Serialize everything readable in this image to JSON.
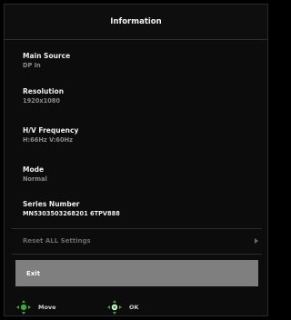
{
  "osd": {
    "title": "Information",
    "items": [
      {
        "label": "Main Source",
        "value": "DP In"
      },
      {
        "label": "Resolution",
        "value": "1920x1080"
      },
      {
        "label": "H/V Frequency",
        "value": "H:66Hz  V:60Hz"
      },
      {
        "label": "Mode",
        "value": "Normal"
      },
      {
        "label": "Series Number",
        "value": "MN5303503268201 6TPV888"
      }
    ],
    "reset_label": "Reset  ALL  Settings",
    "exit_label": "Exit",
    "hints": [
      {
        "label": "Move",
        "icon": "joystick-move-icon"
      },
      {
        "label": "OK",
        "icon": "joystick-ok-icon"
      }
    ],
    "colors": {
      "background": "#0c0c0c",
      "selected": "#7f7f7f",
      "joystick": "#3fa33f"
    }
  }
}
